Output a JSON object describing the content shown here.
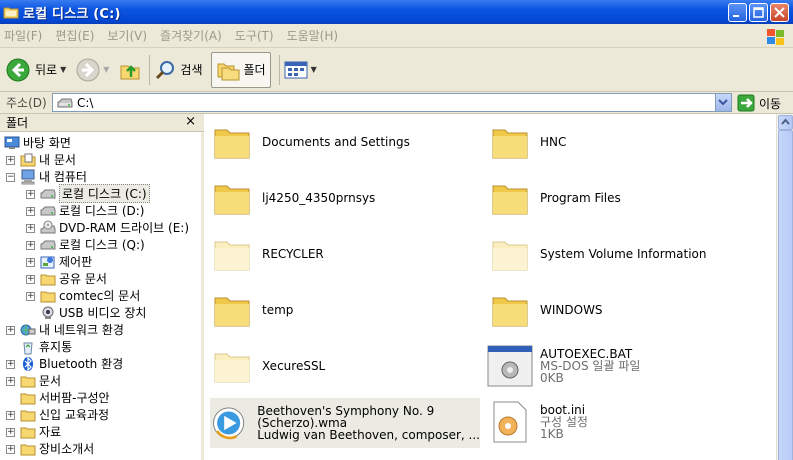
{
  "window": {
    "title": "로컬 디스크 (C:)"
  },
  "menu": [
    "파일(F)",
    "편집(E)",
    "보기(V)",
    "즐겨찾기(A)",
    "도구(T)",
    "도움말(H)"
  ],
  "toolbar": {
    "back": "뒤로",
    "search": "검색",
    "folders": "폴더"
  },
  "address": {
    "label": "주소(D)",
    "value": "C:\\",
    "go": "이동"
  },
  "folder_pane": {
    "title": "폴더",
    "close": "×"
  },
  "tree": [
    {
      "label": "바탕 화면",
      "exp": ""
    },
    {
      "label": "내 문서",
      "exp": "+"
    },
    {
      "label": "내 컴퓨터",
      "exp": "−"
    },
    {
      "label": "로컬 디스크 (C:)",
      "exp": "+"
    },
    {
      "label": "로컬 디스크 (D:)",
      "exp": "+"
    },
    {
      "label": "DVD-RAM 드라이브 (E:)",
      "exp": "+"
    },
    {
      "label": "로컬 디스크 (Q:)",
      "exp": "+"
    },
    {
      "label": "제어판",
      "exp": "+"
    },
    {
      "label": "공유 문서",
      "exp": "+"
    },
    {
      "label": "comtec의 문서",
      "exp": "+"
    },
    {
      "label": "USB 비디오 장치",
      "exp": ""
    },
    {
      "label": "내 네트워크 환경",
      "exp": "+"
    },
    {
      "label": "휴지통",
      "exp": ""
    },
    {
      "label": "Bluetooth 환경",
      "exp": "+"
    },
    {
      "label": "문서",
      "exp": "+"
    },
    {
      "label": "서버팜-구성안",
      "exp": ""
    },
    {
      "label": "신입 교육과정",
      "exp": "+"
    },
    {
      "label": "자료",
      "exp": "+"
    },
    {
      "label": "장비소개서",
      "exp": "+"
    }
  ],
  "files": [
    {
      "name": "Documents and Settings"
    },
    {
      "name": "HNC"
    },
    {
      "name": "lj4250_4350prnsys"
    },
    {
      "name": "Program Files"
    },
    {
      "name": "RECYCLER"
    },
    {
      "name": "System Volume Information"
    },
    {
      "name": "temp"
    },
    {
      "name": "WINDOWS"
    },
    {
      "name": "XecureSSL"
    },
    {
      "name": "AUTOEXEC.BAT",
      "type": "MS-DOS 일괄 파일",
      "size": "0KB"
    },
    {
      "name": "Beethoven's Symphony No. 9 (Scherzo).wma",
      "line1": "Beethoven's Symphony No. 9",
      "line2": "(Scherzo).wma",
      "line3": "Ludwig van Beethoven, composer, ..."
    },
    {
      "name": "boot.ini",
      "type": "구성 설정",
      "size": "1KB"
    }
  ],
  "colors": {
    "titlebar": "#0a54e0",
    "chrome": "#ece9d8",
    "folder": "#f5d66a"
  }
}
